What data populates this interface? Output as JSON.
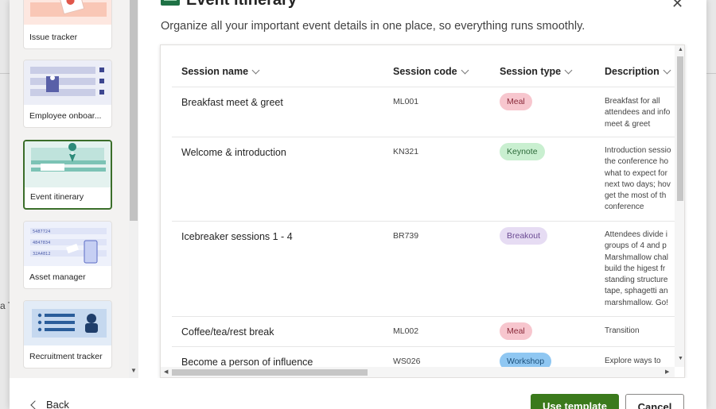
{
  "dialog": {
    "title": "Event itinerary",
    "subtitle": "Organize all your important event details in one place, so everything runs smoothly.",
    "close_icon": "close-icon"
  },
  "templates": [
    {
      "label": "Issue tracker",
      "selected": false
    },
    {
      "label": "Employee onboar...",
      "selected": false
    },
    {
      "label": "Event itinerary",
      "selected": true
    },
    {
      "label": "Asset manager",
      "selected": false
    },
    {
      "label": "Recruitment tracker",
      "selected": false
    }
  ],
  "asset_thumb_codes": [
    "5487724",
    "4847834",
    "32A4812"
  ],
  "table": {
    "columns": [
      {
        "label": "Session name"
      },
      {
        "label": "Session code"
      },
      {
        "label": "Session type"
      },
      {
        "label": "Description"
      }
    ],
    "rows": [
      {
        "name": "Breakfast meet & greet",
        "code": "ML001",
        "type": "Meal",
        "type_bg": "#f7c6ce",
        "type_fg": "#8a2a3a",
        "description": "Breakfast for all\nattendees and info\nmeet & greet"
      },
      {
        "name": "Welcome & introduction",
        "code": "KN321",
        "type": "Keynote",
        "type_bg": "#c9efd0",
        "type_fg": "#2d6b3a",
        "description": "Introduction sessio\nthe conference ho\nwhat to expect for\nnext two days; hov\nget the most of th\nconference"
      },
      {
        "name": "Icebreaker sessions 1 - 4",
        "code": "BR739",
        "type": "Breakout",
        "type_bg": "#e6dcf3",
        "type_fg": "#6b4a93",
        "description": "Attendees divide i\ngroups of 4 and p\nMarshmallow chal\nbuild the higest fr\nstanding structure\ntape, sphagetti an\nmarshmallow. Go!"
      },
      {
        "name": "Coffee/tea/rest break",
        "code": "ML002",
        "type": "Meal",
        "type_bg": "#f7c6ce",
        "type_fg": "#8a2a3a",
        "description": "Transition"
      },
      {
        "name": "Become a person of influence",
        "code": "WS026",
        "type": "Workshop",
        "type_bg": "#8fc7f2",
        "type_fg": "#1b4f7a",
        "description": "Explore ways to"
      }
    ]
  },
  "footer": {
    "back_label": "Back",
    "use_label": "Use template",
    "cancel_label": "Cancel"
  },
  "backdrop_text": "a T",
  "colors": {
    "primary": "#3b7a1c",
    "selected_border": "#3b6e2a",
    "sheet_icon": "#1e7145"
  }
}
